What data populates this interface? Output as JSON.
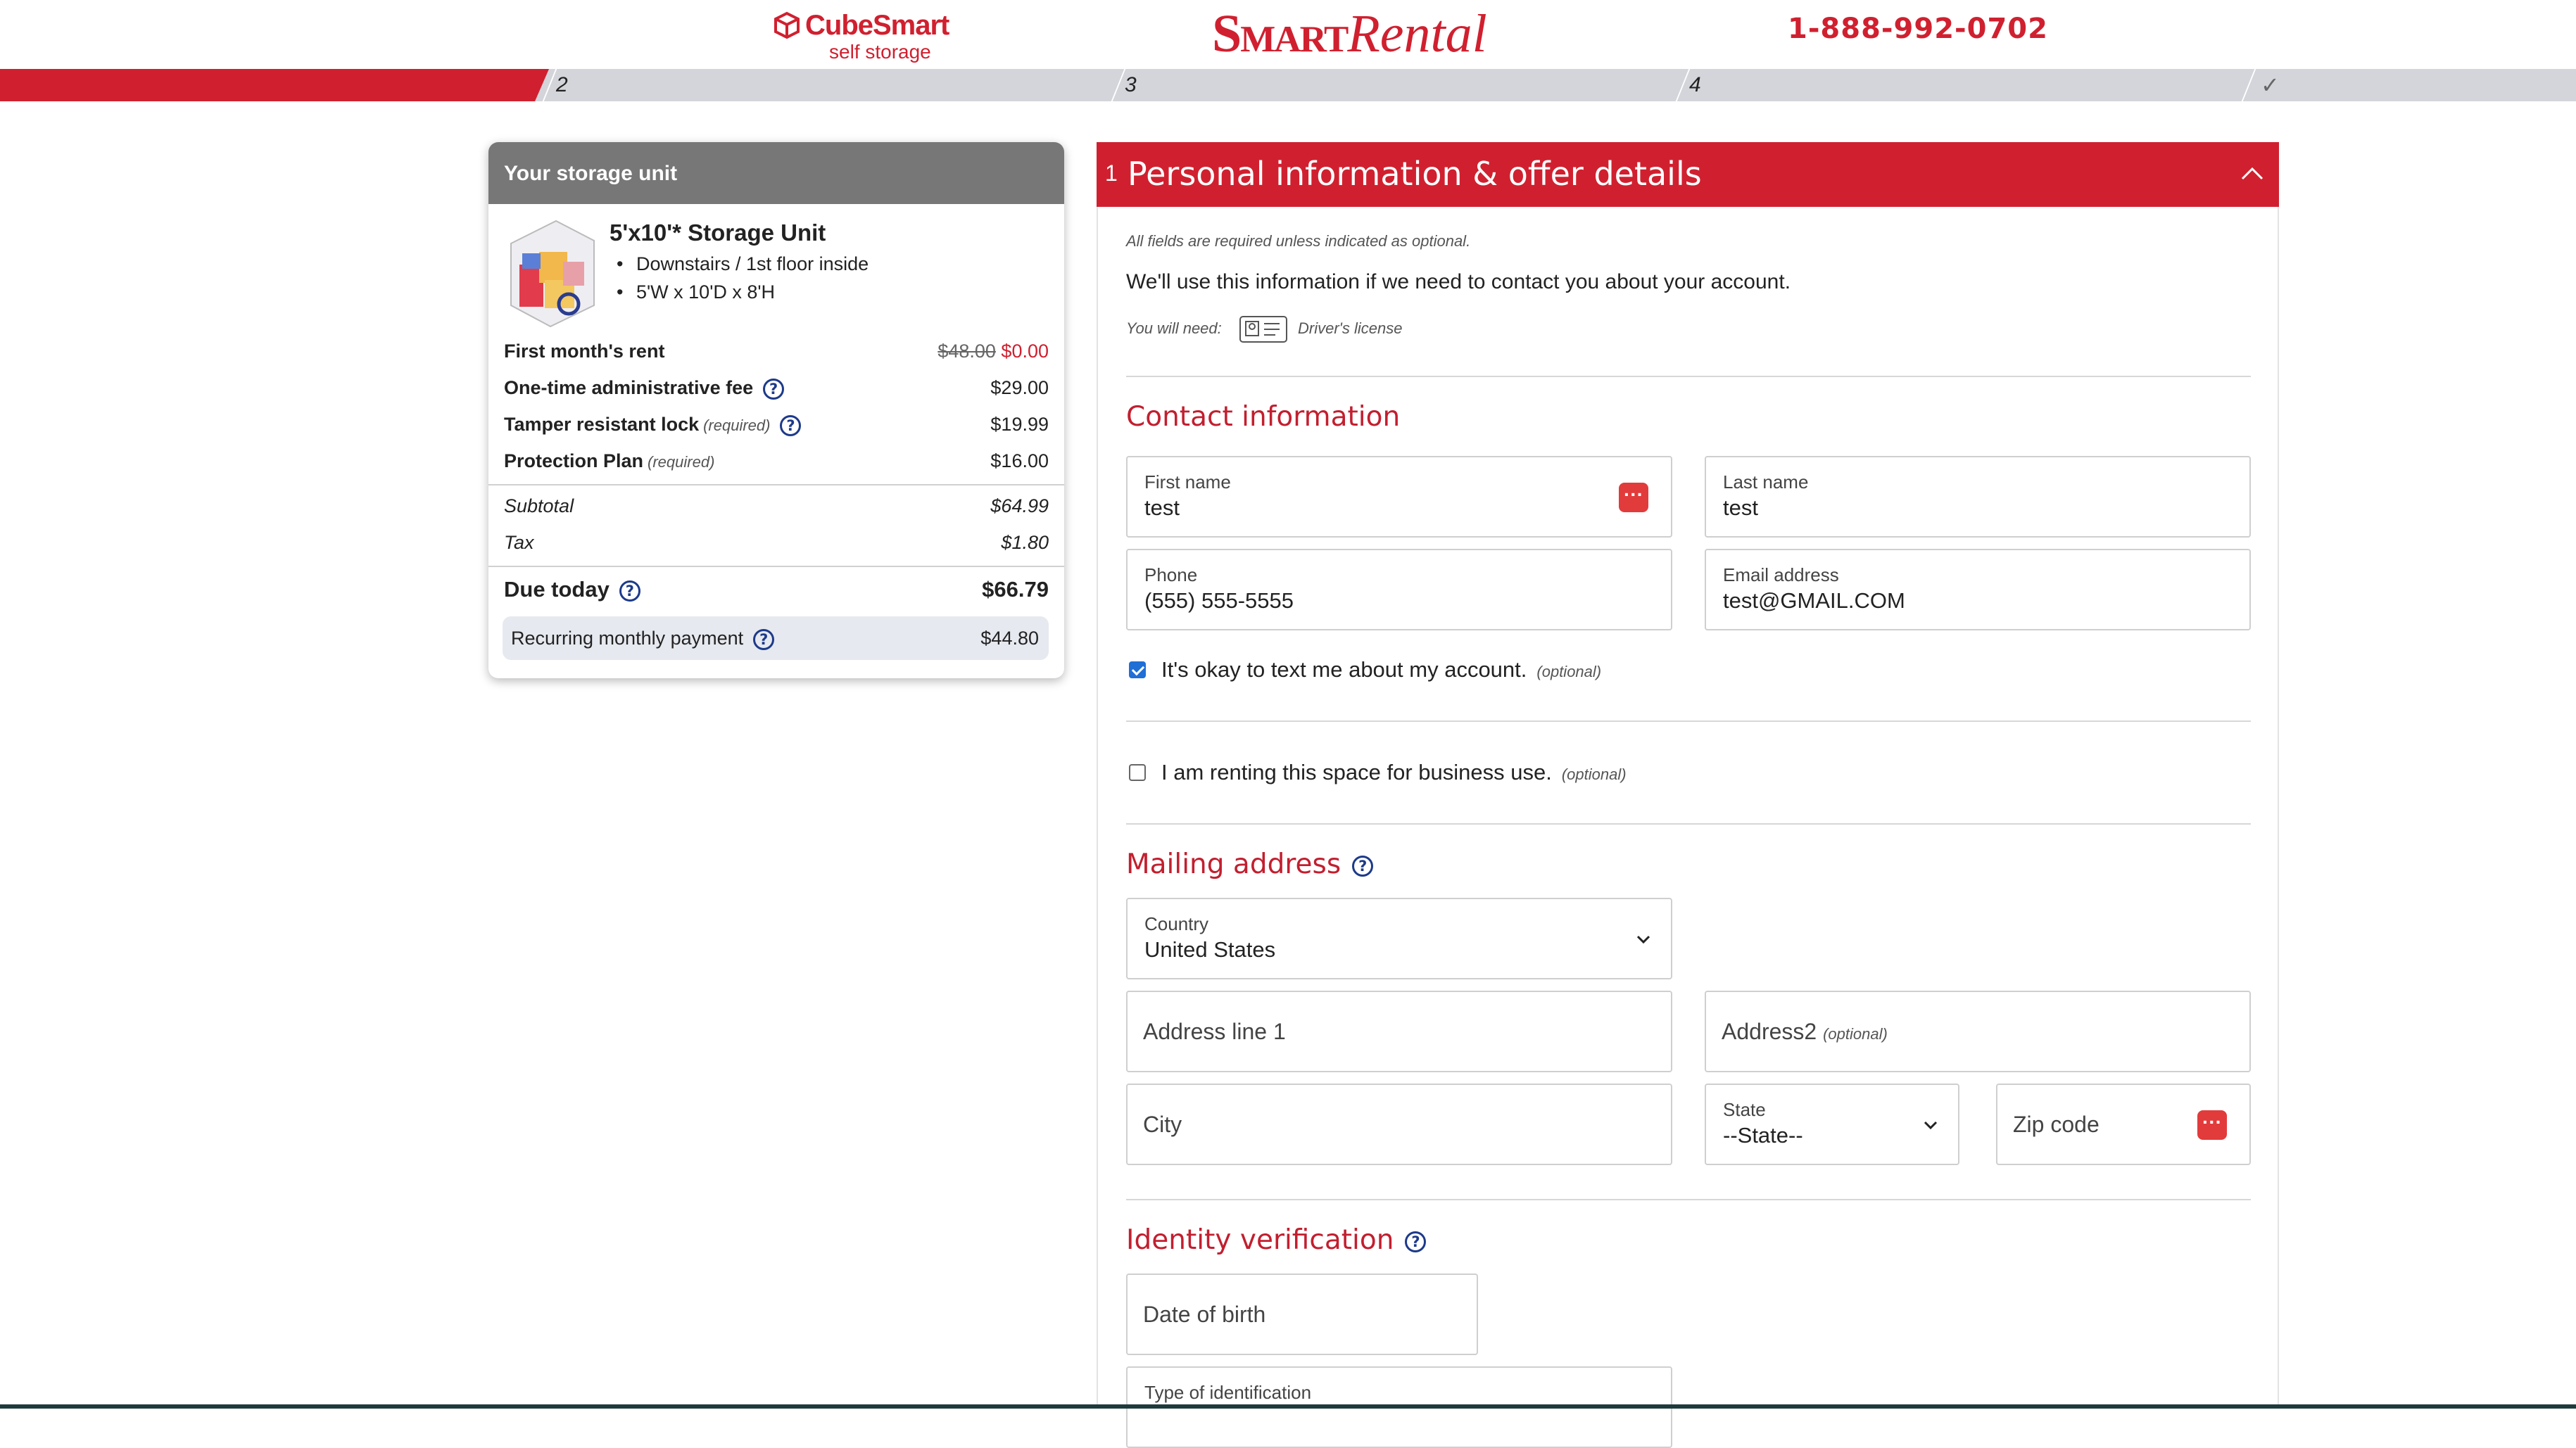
{
  "header": {
    "brand_name": "CubeSmart",
    "brand_sub": "self storage",
    "product_smart": "Smart",
    "product_rental": "Rental",
    "phone": "1-888-992-0702"
  },
  "progress": {
    "steps": [
      "2",
      "3",
      "4"
    ],
    "final_icon": "checkmark-icon"
  },
  "summary": {
    "title": "Your storage unit",
    "unit_name": "5'x10'* Storage Unit",
    "features": [
      "Downstairs / 1st floor inside",
      "5'W x 10'D x 8'H"
    ],
    "first_month_label": "First month's rent",
    "first_month_old": "$48.00",
    "first_month_new": "$0.00",
    "admin_fee_label": "One-time administrative fee",
    "admin_fee_value": "$29.00",
    "lock_label": "Tamper resistant lock",
    "lock_required": "(required)",
    "lock_value": "$19.99",
    "protection_label": "Protection Plan",
    "protection_required": "(required)",
    "protection_value": "$16.00",
    "subtotal_label": "Subtotal",
    "subtotal_value": "$64.99",
    "tax_label": "Tax",
    "tax_value": "$1.80",
    "due_label": "Due today",
    "due_value": "$66.79",
    "recurring_label": "Recurring monthly payment",
    "recurring_value": "$44.80"
  },
  "panel": {
    "step_number": "1",
    "title": "Personal information & offer details",
    "required_note": "All fields are required unless indicated as optional.",
    "intro": "We'll use this information if we need to contact you about your account.",
    "need_label": "You will need:",
    "need_item": "Driver's license",
    "contact_title": "Contact information",
    "first_name_label": "First name",
    "first_name_value": "test",
    "last_name_label": "Last name",
    "last_name_value": "test",
    "phone_label": "Phone",
    "phone_value": "(555) 555-5555",
    "email_label": "Email address",
    "email_value": "test@GMAIL.COM",
    "text_ok_label": "It's okay to text me about my account.",
    "optional": "(optional)",
    "business_label": "I am renting this space for business use.",
    "mailing_title": "Mailing address",
    "country_label": "Country",
    "country_value": "United States",
    "address1_placeholder": "Address line 1",
    "address2_placeholder": "Address2",
    "city_placeholder": "City",
    "state_label": "State",
    "state_value": "--State--",
    "zip_placeholder": "Zip code",
    "identity_title": "Identity verification",
    "dob_placeholder": "Date of birth",
    "id_type_label": "Type of identification"
  },
  "colors": {
    "brand_red": "#d0202f",
    "card_header_gray": "#777777",
    "help_blue": "#1d3a8a",
    "checkbox_blue": "#1f6fd6"
  }
}
